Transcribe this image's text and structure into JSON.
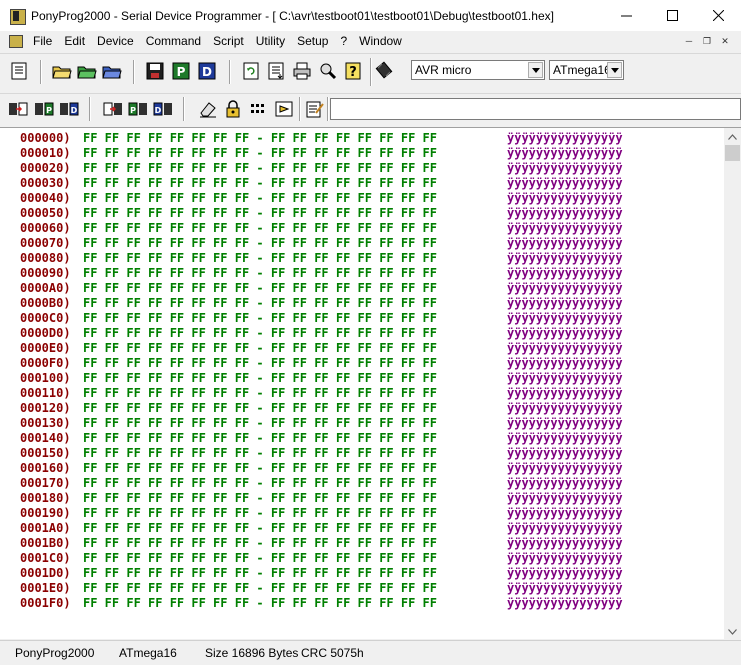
{
  "window": {
    "title": "PonyProg2000 - Serial Device Programmer - [ C:\\avr\\testboot01\\testboot01\\Debug\\testboot01.hex]"
  },
  "menu": [
    "File",
    "Edit",
    "Device",
    "Command",
    "Script",
    "Utility",
    "Setup",
    "?",
    "Window"
  ],
  "toolbar": {
    "device_family": "AVR micro",
    "device_type": "ATmega16",
    "command_text": ""
  },
  "hex": {
    "rows": [
      {
        "addr": "000000)",
        "bytes": "FF FF FF FF FF FF FF FF - FF FF FF FF FF FF FF FF",
        "ascii": "ÿÿÿÿÿÿÿÿÿÿÿÿÿÿÿÿ"
      },
      {
        "addr": "000010)",
        "bytes": "FF FF FF FF FF FF FF FF - FF FF FF FF FF FF FF FF",
        "ascii": "ÿÿÿÿÿÿÿÿÿÿÿÿÿÿÿÿ"
      },
      {
        "addr": "000020)",
        "bytes": "FF FF FF FF FF FF FF FF - FF FF FF FF FF FF FF FF",
        "ascii": "ÿÿÿÿÿÿÿÿÿÿÿÿÿÿÿÿ"
      },
      {
        "addr": "000030)",
        "bytes": "FF FF FF FF FF FF FF FF - FF FF FF FF FF FF FF FF",
        "ascii": "ÿÿÿÿÿÿÿÿÿÿÿÿÿÿÿÿ"
      },
      {
        "addr": "000040)",
        "bytes": "FF FF FF FF FF FF FF FF - FF FF FF FF FF FF FF FF",
        "ascii": "ÿÿÿÿÿÿÿÿÿÿÿÿÿÿÿÿ"
      },
      {
        "addr": "000050)",
        "bytes": "FF FF FF FF FF FF FF FF - FF FF FF FF FF FF FF FF",
        "ascii": "ÿÿÿÿÿÿÿÿÿÿÿÿÿÿÿÿ"
      },
      {
        "addr": "000060)",
        "bytes": "FF FF FF FF FF FF FF FF - FF FF FF FF FF FF FF FF",
        "ascii": "ÿÿÿÿÿÿÿÿÿÿÿÿÿÿÿÿ"
      },
      {
        "addr": "000070)",
        "bytes": "FF FF FF FF FF FF FF FF - FF FF FF FF FF FF FF FF",
        "ascii": "ÿÿÿÿÿÿÿÿÿÿÿÿÿÿÿÿ"
      },
      {
        "addr": "000080)",
        "bytes": "FF FF FF FF FF FF FF FF - FF FF FF FF FF FF FF FF",
        "ascii": "ÿÿÿÿÿÿÿÿÿÿÿÿÿÿÿÿ"
      },
      {
        "addr": "000090)",
        "bytes": "FF FF FF FF FF FF FF FF - FF FF FF FF FF FF FF FF",
        "ascii": "ÿÿÿÿÿÿÿÿÿÿÿÿÿÿÿÿ"
      },
      {
        "addr": "0000A0)",
        "bytes": "FF FF FF FF FF FF FF FF - FF FF FF FF FF FF FF FF",
        "ascii": "ÿÿÿÿÿÿÿÿÿÿÿÿÿÿÿÿ"
      },
      {
        "addr": "0000B0)",
        "bytes": "FF FF FF FF FF FF FF FF - FF FF FF FF FF FF FF FF",
        "ascii": "ÿÿÿÿÿÿÿÿÿÿÿÿÿÿÿÿ"
      },
      {
        "addr": "0000C0)",
        "bytes": "FF FF FF FF FF FF FF FF - FF FF FF FF FF FF FF FF",
        "ascii": "ÿÿÿÿÿÿÿÿÿÿÿÿÿÿÿÿ"
      },
      {
        "addr": "0000D0)",
        "bytes": "FF FF FF FF FF FF FF FF - FF FF FF FF FF FF FF FF",
        "ascii": "ÿÿÿÿÿÿÿÿÿÿÿÿÿÿÿÿ"
      },
      {
        "addr": "0000E0)",
        "bytes": "FF FF FF FF FF FF FF FF - FF FF FF FF FF FF FF FF",
        "ascii": "ÿÿÿÿÿÿÿÿÿÿÿÿÿÿÿÿ"
      },
      {
        "addr": "0000F0)",
        "bytes": "FF FF FF FF FF FF FF FF - FF FF FF FF FF FF FF FF",
        "ascii": "ÿÿÿÿÿÿÿÿÿÿÿÿÿÿÿÿ"
      },
      {
        "addr": "000100)",
        "bytes": "FF FF FF FF FF FF FF FF - FF FF FF FF FF FF FF FF",
        "ascii": "ÿÿÿÿÿÿÿÿÿÿÿÿÿÿÿÿ"
      },
      {
        "addr": "000110)",
        "bytes": "FF FF FF FF FF FF FF FF - FF FF FF FF FF FF FF FF",
        "ascii": "ÿÿÿÿÿÿÿÿÿÿÿÿÿÿÿÿ"
      },
      {
        "addr": "000120)",
        "bytes": "FF FF FF FF FF FF FF FF - FF FF FF FF FF FF FF FF",
        "ascii": "ÿÿÿÿÿÿÿÿÿÿÿÿÿÿÿÿ"
      },
      {
        "addr": "000130)",
        "bytes": "FF FF FF FF FF FF FF FF - FF FF FF FF FF FF FF FF",
        "ascii": "ÿÿÿÿÿÿÿÿÿÿÿÿÿÿÿÿ"
      },
      {
        "addr": "000140)",
        "bytes": "FF FF FF FF FF FF FF FF - FF FF FF FF FF FF FF FF",
        "ascii": "ÿÿÿÿÿÿÿÿÿÿÿÿÿÿÿÿ"
      },
      {
        "addr": "000150)",
        "bytes": "FF FF FF FF FF FF FF FF - FF FF FF FF FF FF FF FF",
        "ascii": "ÿÿÿÿÿÿÿÿÿÿÿÿÿÿÿÿ"
      },
      {
        "addr": "000160)",
        "bytes": "FF FF FF FF FF FF FF FF - FF FF FF FF FF FF FF FF",
        "ascii": "ÿÿÿÿÿÿÿÿÿÿÿÿÿÿÿÿ"
      },
      {
        "addr": "000170)",
        "bytes": "FF FF FF FF FF FF FF FF - FF FF FF FF FF FF FF FF",
        "ascii": "ÿÿÿÿÿÿÿÿÿÿÿÿÿÿÿÿ"
      },
      {
        "addr": "000180)",
        "bytes": "FF FF FF FF FF FF FF FF - FF FF FF FF FF FF FF FF",
        "ascii": "ÿÿÿÿÿÿÿÿÿÿÿÿÿÿÿÿ"
      },
      {
        "addr": "000190)",
        "bytes": "FF FF FF FF FF FF FF FF - FF FF FF FF FF FF FF FF",
        "ascii": "ÿÿÿÿÿÿÿÿÿÿÿÿÿÿÿÿ"
      },
      {
        "addr": "0001A0)",
        "bytes": "FF FF FF FF FF FF FF FF - FF FF FF FF FF FF FF FF",
        "ascii": "ÿÿÿÿÿÿÿÿÿÿÿÿÿÿÿÿ"
      },
      {
        "addr": "0001B0)",
        "bytes": "FF FF FF FF FF FF FF FF - FF FF FF FF FF FF FF FF",
        "ascii": "ÿÿÿÿÿÿÿÿÿÿÿÿÿÿÿÿ"
      },
      {
        "addr": "0001C0)",
        "bytes": "FF FF FF FF FF FF FF FF - FF FF FF FF FF FF FF FF",
        "ascii": "ÿÿÿÿÿÿÿÿÿÿÿÿÿÿÿÿ"
      },
      {
        "addr": "0001D0)",
        "bytes": "FF FF FF FF FF FF FF FF - FF FF FF FF FF FF FF FF",
        "ascii": "ÿÿÿÿÿÿÿÿÿÿÿÿÿÿÿÿ"
      },
      {
        "addr": "0001E0)",
        "bytes": "FF FF FF FF FF FF FF FF - FF FF FF FF FF FF FF FF",
        "ascii": "ÿÿÿÿÿÿÿÿÿÿÿÿÿÿÿÿ"
      },
      {
        "addr": "0001F0)",
        "bytes": "FF FF FF FF FF FF FF FF - FF FF FF FF FF FF FF FF",
        "ascii": "ÿÿÿÿÿÿÿÿÿÿÿÿÿÿÿÿ"
      }
    ]
  },
  "status": {
    "app": "PonyProg2000",
    "device": "ATmega16",
    "size": "Size 16896 Bytes",
    "crc": "CRC  5075h"
  },
  "colors": {
    "address": "#8b0000",
    "bytes": "#008000",
    "ascii": "#800080"
  },
  "icons": {
    "toolbar1": [
      "edit-buffer-icon",
      "open-file-icon",
      "open-program-icon",
      "open-data-icon",
      "save-icon",
      "save-program-icon",
      "save-data-icon",
      "reload-icon",
      "file-info-icon",
      "print-icon",
      "setup-icon",
      "help-icon",
      "device-chip-icon"
    ],
    "toolbar2": [
      "read-all-icon",
      "read-program-icon",
      "read-data-icon",
      "write-all-icon",
      "write-program-icon",
      "write-data-icon",
      "erase-icon",
      "security-lock-icon",
      "config-bits-icon",
      "program-icon",
      "script-edit-icon"
    ]
  }
}
